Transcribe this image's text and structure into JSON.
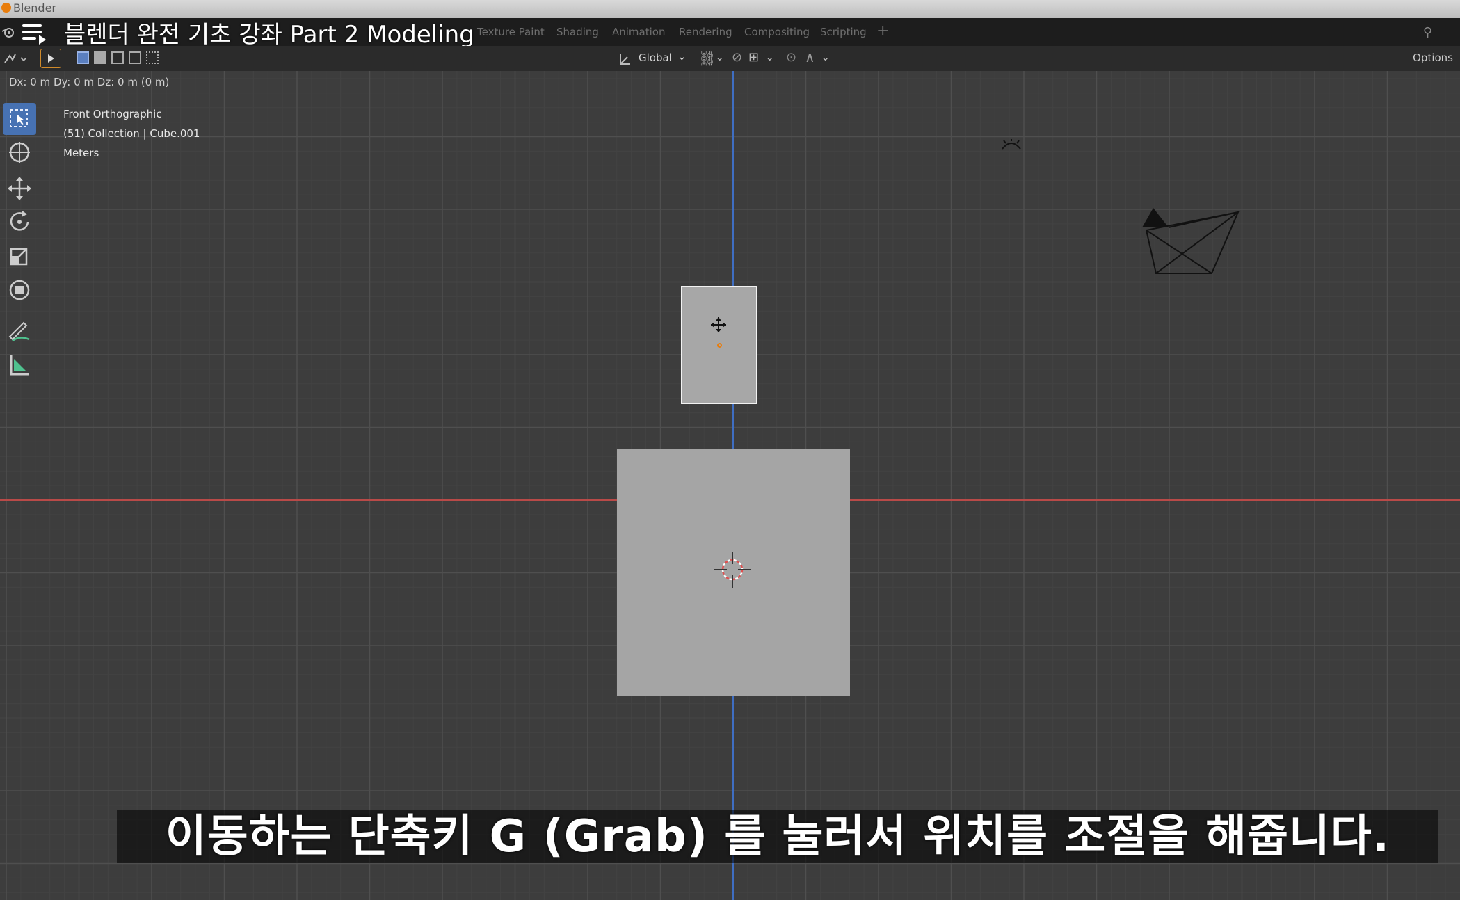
{
  "window": {
    "title": "Blender"
  },
  "video": {
    "title": "블렌더 완전 기초 강좌 Part 2 Modeling"
  },
  "workspace_tabs": [
    {
      "label": "Texture Paint"
    },
    {
      "label": "Shading"
    },
    {
      "label": "Animation"
    },
    {
      "label": "Rendering"
    },
    {
      "label": "Compositing"
    },
    {
      "label": "Scripting"
    }
  ],
  "header": {
    "transform_orientation": "Global",
    "options_label": "Options"
  },
  "viewport": {
    "delta_readout": "Dx: 0 m   Dy: 0 m   Dz: 0 m (0 m)",
    "view_name": "Front Orthographic",
    "collection_info": "(51) Collection | Cube.001",
    "units": "Meters"
  },
  "toolbar_tools": [
    {
      "icon": "select-box-icon",
      "active": true
    },
    {
      "icon": "cursor-icon",
      "active": false
    },
    {
      "icon": "move-icon",
      "active": false
    },
    {
      "icon": "rotate-icon",
      "active": false
    },
    {
      "icon": "scale-icon",
      "active": false
    },
    {
      "icon": "transform-icon",
      "active": false
    },
    {
      "icon": "annotate-icon",
      "active": false
    },
    {
      "icon": "measure-icon",
      "active": false
    }
  ],
  "subtitle": "이동하는 단축키  G (Grab) 를 눌러서 위치를 조절을 해줍니다.",
  "colors": {
    "viewport_bg": "#3d3d3d",
    "x_axis": "#b94a48",
    "z_axis": "#3f6ec2",
    "selection": "#e87d0d",
    "active_tool": "#4772b3"
  }
}
